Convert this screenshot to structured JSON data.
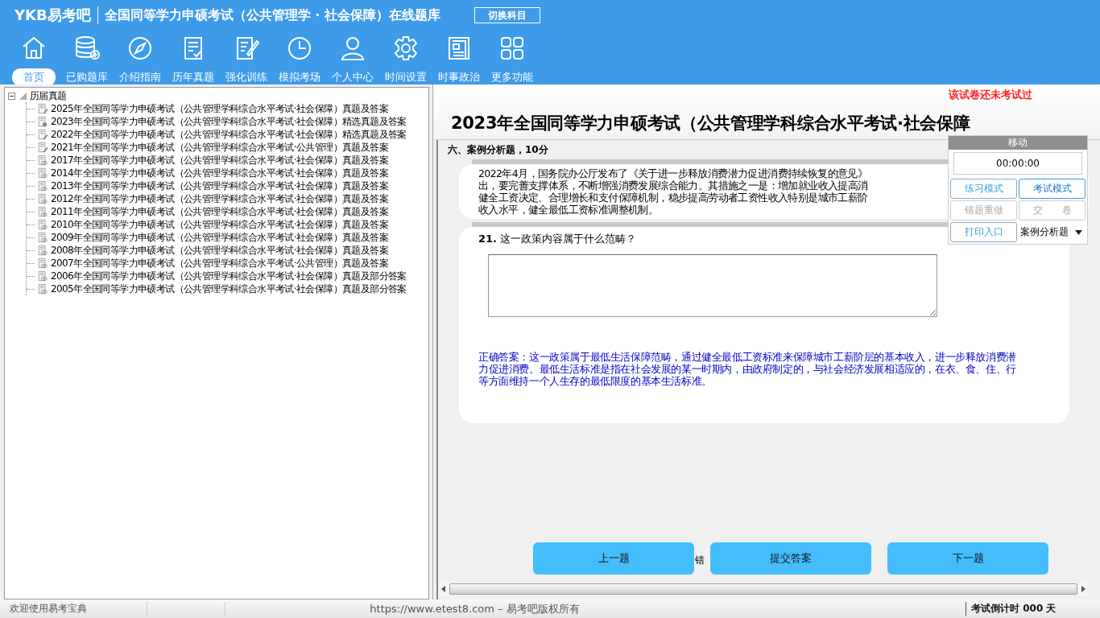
{
  "header": {
    "logo": "YKB易考吧",
    "title": "全国同等学力申硕考试（公共管理学 · 社会保障）在线题库",
    "switch_button": "切换科目"
  },
  "toolbar": [
    {
      "label": "首页",
      "selected": true
    },
    {
      "label": "已购题库",
      "selected": false
    },
    {
      "label": "介绍指南",
      "selected": false
    },
    {
      "label": "历年真题",
      "selected": false
    },
    {
      "label": "强化训练",
      "selected": false
    },
    {
      "label": "模拟考场",
      "selected": false
    },
    {
      "label": "个人中心",
      "selected": false
    },
    {
      "label": "时间设置",
      "selected": false
    },
    {
      "label": "时事政治",
      "selected": false
    },
    {
      "label": "更多功能",
      "selected": false
    }
  ],
  "tree": {
    "root": {
      "label": "历届真题",
      "expanded": true,
      "children": [
        {
          "label": "2025年全国同等学力申硕考试（公共管理学科综合水平考试·社会保障）真题及答案",
          "kind": "edit"
        },
        {
          "label": "2023年全国同等学力申硕考试（公共管理学科综合水平考试·社会保障）精选真题及答案",
          "kind": "pin"
        },
        {
          "label": "2022年全国同等学力申硕考试（公共管理学科综合水平考试·社会保障）精选真题及答案",
          "kind": "edit"
        },
        {
          "label": "2021年全国同等学力申硕考试（公共管理学科综合水平考试·公共管理）真题及答案",
          "kind": "edit"
        },
        {
          "label": "2017年全国同等学力申硕考试（公共管理学科综合水平考试·社会保障）真题及答案",
          "kind": "view"
        },
        {
          "label": "2014年全国同等学力申硕考试（公共管理学科综合水平考试·社会保障）真题及答案",
          "kind": "view"
        },
        {
          "label": "2013年全国同等学力申硕考试（公共管理学科综合水平考试·社会保障）真题及答案",
          "kind": "view"
        },
        {
          "label": "2012年全国同等学力申硕考试（公共管理学科综合水平考试·社会保障）真题及答案",
          "kind": "view"
        },
        {
          "label": "2011年全国同等学力申硕考试（公共管理学科综合水平考试·社会保障）真题及答案",
          "kind": "view"
        },
        {
          "label": "2010年全国同等学力申硕考试（公共管理学科综合水平考试·社会保障）真题及答案",
          "kind": "view"
        },
        {
          "label": "2009年全国同等学力申硕考试（公共管理学科综合水平考试·社会保障）真题及答案",
          "kind": "view"
        },
        {
          "label": "2008年全国同等学力申硕考试（公共管理学科综合水平考试·社会保障）真题及答案",
          "kind": "view"
        },
        {
          "label": "2007年全国同等学力申硕考试（公共管理学科综合水平考试·公共管理）真题及答案",
          "kind": "view"
        },
        {
          "label": "2006年全国同等学力申硕考试（公共管理学科综合水平考试·社会保障）真题及部分答案",
          "kind": "view"
        },
        {
          "label": "2005年全国同等学力申硕考试（公共管理学科综合水平考试·社会保障）真题及部分答案",
          "kind": "view"
        }
      ]
    }
  },
  "exam": {
    "title": "2023年全国同等学力申硕考试（公共管理学科综合水平考试·社会保障",
    "notice": "该试卷还未考试过",
    "section": "六、案例分析题，10分",
    "passage": [
      "2022年4月，国务院办公厅发布了《关于进一步释放消费潜力促进消费持续恢复的意见》",
      "出，要完善支撑体系，不断增强消费发展综合能力。其措施之一是：增加就业收入提高消",
      "健全工资决定、合理增长和支付保障机制，稳步提高劳动者工资性收入特别是城市工薪阶",
      "收入水平，健全最低工资标准调整机制。"
    ],
    "question_number": "21.",
    "question": "这一政策内容属于什么范畴？",
    "answer": "正确答案：这一政策属于最低生活保障范畴，通过健全最低工资标准来保障城市工薪阶层的基本收入，进一步释放消费潜力促进消费。最低生活标准是指在社会发展的某一时期内，由政府制定的，与社会经济发展相适应的，在衣、食、住、行等方面维持一个人生存的最低限度的基本生活标准。",
    "nav_buttons": [
      "上一题",
      "提交答案",
      "下一题"
    ],
    "hidden_label": "错"
  },
  "panel": {
    "header": "移动",
    "timer": "00:00:00",
    "modes": [
      {
        "label": "练习模式",
        "selected": false
      },
      {
        "label": "考试模式",
        "selected": true
      }
    ],
    "actions": [
      {
        "label": "错题重做",
        "disabled": true
      },
      {
        "label": "交　　卷",
        "disabled": true
      },
      {
        "label": "打印入口",
        "disabled": false
      }
    ],
    "type_select": "案例分析题"
  },
  "status_bar": {
    "welcome": "欢迎使用易考宝典",
    "copyright": "https://www.etest8.com – 易考吧版权所有",
    "countdown": "考试倒计时 000 天"
  }
}
